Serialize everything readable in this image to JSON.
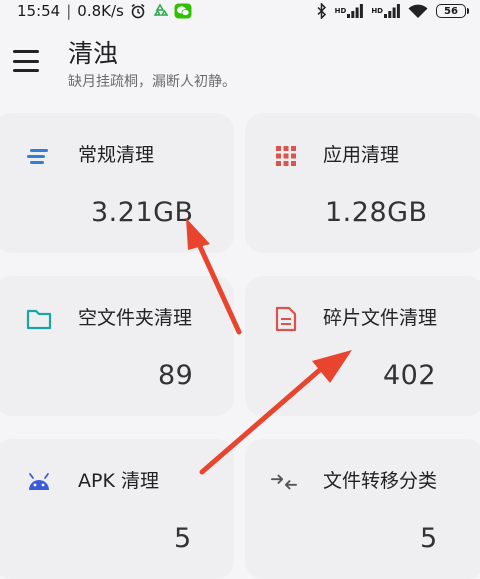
{
  "status_bar": {
    "time": "15:54",
    "separator": "|",
    "net_speed": "0.8K/s",
    "hd1": "HD",
    "hd2": "HD",
    "battery": "56"
  },
  "header": {
    "title": "清浊",
    "subtitle": "缺月挂疏桐，漏断人初静。"
  },
  "cards": [
    {
      "label": "常规清理",
      "value": "3.21GB",
      "icon": "lines-icon",
      "color": "#2f7fd8"
    },
    {
      "label": "应用清理",
      "value": "1.28GB",
      "icon": "grid-icon",
      "color": "#d9534f"
    },
    {
      "label": "空文件夹清理",
      "value": "89",
      "icon": "folder-icon",
      "color": "#1aa5a5"
    },
    {
      "label": "碎片文件清理",
      "value": "402",
      "icon": "document-icon",
      "color": "#d9534f"
    },
    {
      "label": "APK 清理",
      "value": "5",
      "icon": "android-icon",
      "color": "#3b5bdb"
    },
    {
      "label": "文件转移分类",
      "value": "5",
      "icon": "transfer-icon",
      "color": "#555555"
    }
  ],
  "annotation_color": "#e8442e"
}
